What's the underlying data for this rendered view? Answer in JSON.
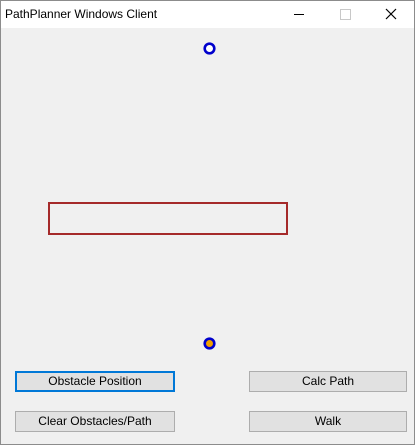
{
  "window": {
    "title": "PathPlanner Windows Client",
    "controls": {
      "minimize_icon": "minimize-icon",
      "maximize_icon": "maximize-icon",
      "close_icon": "close-icon"
    }
  },
  "canvas": {
    "start_marker": {
      "color": "#0000cc",
      "fill": "#ffffff"
    },
    "goal_marker": {
      "color": "#0000cc",
      "fill": "#f0a000"
    },
    "obstacle": {
      "color": "#a52a2a"
    }
  },
  "buttons": {
    "obstacle_position": "Obstacle Position",
    "calc_path": "Calc Path",
    "clear_obstacles_path": "Clear Obstacles/Path",
    "walk": "Walk"
  },
  "colors": {
    "focus_border": "#0078d7",
    "button_face": "#e1e1e1",
    "window_bg": "#f0f0f0"
  }
}
